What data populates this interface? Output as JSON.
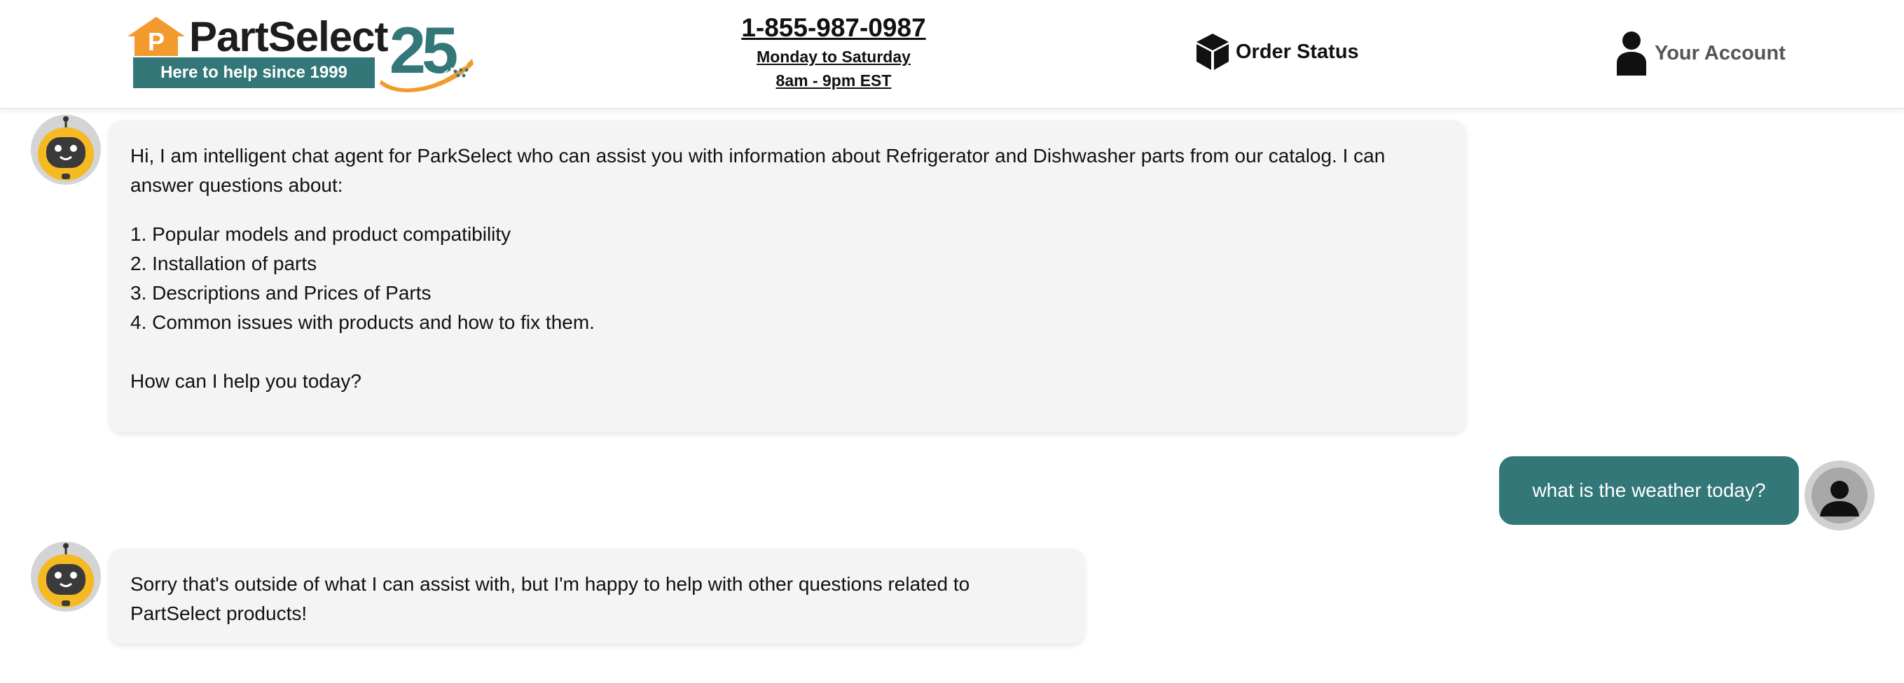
{
  "header": {
    "logo": {
      "brand": "PartSelect",
      "house_letter": "P",
      "tagline": "Here to help since 1999",
      "anniversary_number": "25",
      "anniversary_label": "YEARS"
    },
    "phone": "1-855-987-0987",
    "hours_days": "Monday to Saturday",
    "hours_time": "8am - 9pm EST",
    "order_status_label": "Order Status",
    "account_label": "Your Account"
  },
  "colors": {
    "brand_teal": "#337778",
    "brand_orange": "#f29a2e",
    "bot_bubble": "#f4f4f4",
    "robot_yellow": "#f5b921"
  },
  "chat": {
    "messages": [
      {
        "sender": "bot",
        "avatar_icon": "robot-avatar-icon",
        "intro": "Hi, I am intelligent chat agent for ParkSelect who can assist you with information about Refrigerator and Dishwasher parts from our catalog. I can answer questions about:",
        "list": [
          "1. Popular models and product compatibility",
          "2. Installation of parts",
          "3. Descriptions and Prices of Parts",
          "4. Common issues with products and how to fix them."
        ],
        "closing": "How can I help you today?"
      },
      {
        "sender": "user",
        "avatar_icon": "user-avatar-icon",
        "text": "what is the weather today?"
      },
      {
        "sender": "bot",
        "avatar_icon": "robot-avatar-icon",
        "text": "Sorry that's outside of what I can assist with, but I'm happy to help with other questions related to PartSelect products!"
      }
    ]
  }
}
